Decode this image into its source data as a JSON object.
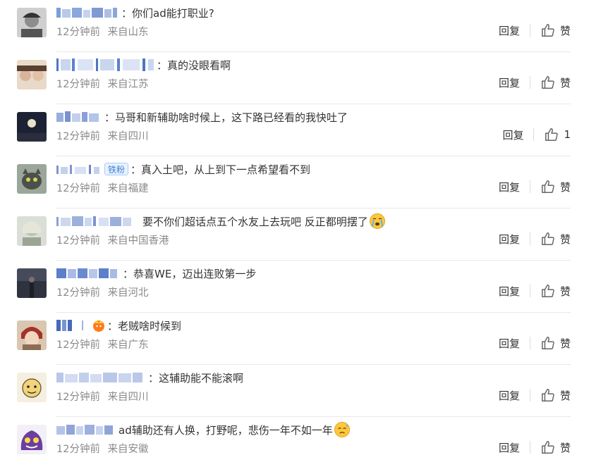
{
  "comments": [
    {
      "separator": "：",
      "text": "你们ad能打职业?",
      "time": "12分钟前",
      "location": "来自山东",
      "reply": "回复",
      "like": "赞",
      "badge": "",
      "emoji": ""
    },
    {
      "separator": "：",
      "text": "真的没眼看啊",
      "time": "12分钟前",
      "location": "来自江苏",
      "reply": "回复",
      "like": "赞",
      "badge": "",
      "emoji": ""
    },
    {
      "separator": "：",
      "text": "马哥和新辅助啥时候上，这下路已经看的我快吐了",
      "time": "12分钟前",
      "location": "来自四川",
      "reply": "回复",
      "like": "1",
      "badge": "",
      "emoji": ""
    },
    {
      "separator": "：",
      "text": "真入土吧，从上到下一点希望看不到",
      "time": "12分钟前",
      "location": "来自福建",
      "reply": "回复",
      "like": "赞",
      "badge": "铁粉",
      "emoji": ""
    },
    {
      "separator": "：",
      "text": "要不你们超话点五个水友上去玩吧 反正都明摆了",
      "time": "12分钟前",
      "location": "来自中国香港",
      "reply": "回复",
      "like": "赞",
      "badge": "",
      "emoji": "crying-face"
    },
    {
      "separator": "：",
      "text": "恭喜WE，迈出连败第一步",
      "time": "12分钟前",
      "location": "来自河北",
      "reply": "回复",
      "like": "赞",
      "badge": "",
      "emoji": ""
    },
    {
      "separator": "：",
      "text": "老贼啥时候到",
      "time": "12分钟前",
      "location": "来自广东",
      "reply": "回复",
      "like": "赞",
      "badge": "",
      "emoji": ""
    },
    {
      "separator": "：",
      "text": "这辅助能不能滚啊",
      "time": "12分钟前",
      "location": "来自四川",
      "reply": "回复",
      "like": "赞",
      "badge": "",
      "emoji": ""
    },
    {
      "separator": "：",
      "text": "ad辅助还有人换，打野呢，悲伤一年不如一年",
      "time": "12分钟前",
      "location": "来自安徽",
      "reply": "回复",
      "like": "赞",
      "badge": "",
      "emoji": "sad-sweat-face"
    }
  ],
  "colors": {
    "meta_text": "#8a8a8a",
    "badge_text": "#3e82d6",
    "badge_bg": "#e8f2ff",
    "divider": "#e8e8e8"
  }
}
